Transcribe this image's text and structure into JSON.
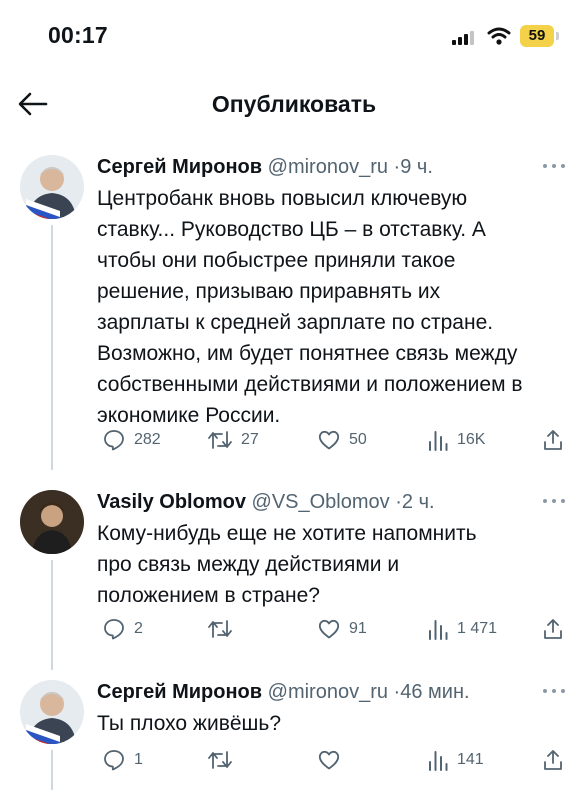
{
  "status_bar": {
    "time": "00:17",
    "battery": "59"
  },
  "header": {
    "title": "Опубликовать"
  },
  "colors": {
    "accent_battery": "#f3d24a",
    "meta_gray": "#536471",
    "thread_line": "#cfd9de"
  },
  "tweets": [
    {
      "name": "Сергей Миронов",
      "handle": "@mironov_ru",
      "time": "9 ч.",
      "lines": [
        "Центробанк вновь повысил ключевую",
        "ставку... Руководство ЦБ – в отставку. А",
        "чтобы они побыстрее приняли такое",
        "решение, призываю приравнять их",
        "зарплаты к средней зарплате по стране.",
        "Возможно, им будет понятнее связь между",
        "собственными действиями и положением в",
        "экономике России."
      ],
      "replies": "282",
      "retweets": "27",
      "likes": "50",
      "views": "16K"
    },
    {
      "name": "Vasily Oblomov",
      "handle": "@VS_Oblomov",
      "time": "2 ч.",
      "lines": [
        "Кому-нибудь еще не хотите напомнить",
        "про связь между действиями и",
        "положением в стране?"
      ],
      "replies": "2",
      "retweets": "",
      "likes": "91",
      "views": "1 471"
    },
    {
      "name": "Сергей Миронов",
      "handle": "@mironov_ru",
      "time": "46 мин.",
      "lines": [
        "Ты плохо живёшь?"
      ],
      "replies": "1",
      "retweets": "",
      "likes": "",
      "views": "141"
    }
  ]
}
